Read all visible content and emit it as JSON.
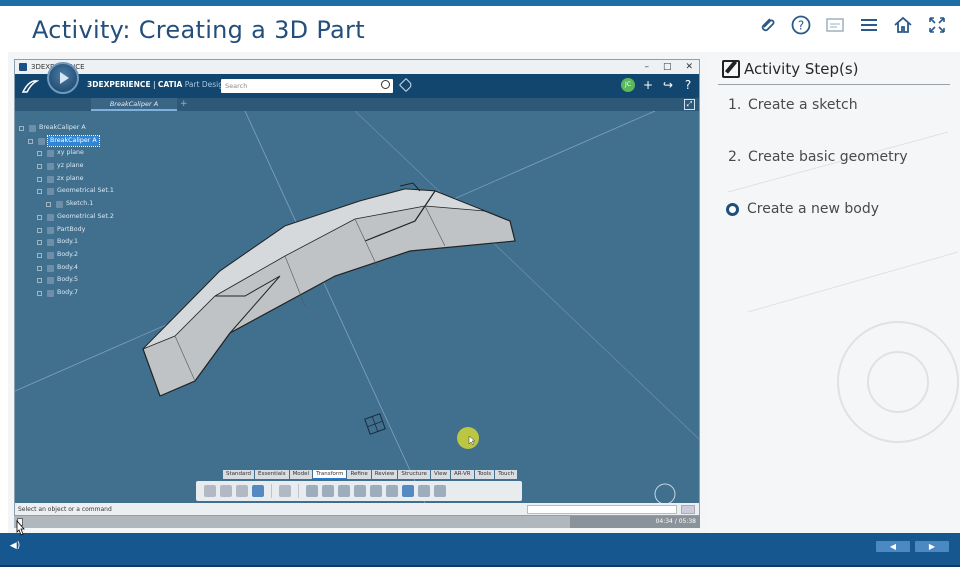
{
  "course": {
    "title": "Activity: Creating a 3D Part",
    "header_icons": [
      "paperclip-icon",
      "help-icon",
      "captions-icon",
      "menu-icon",
      "home-icon",
      "fullscreen-icon"
    ]
  },
  "app": {
    "window_title": "3DEXPERIENCE",
    "window_controls": [
      "–",
      "□",
      "✕"
    ],
    "brand_bold": "3DEXPERIENCE",
    "brand_separator": " | ",
    "brand_app": "CATIA",
    "brand_sub": " Part Design",
    "search_placeholder": "Search",
    "avatar_initials": "JC",
    "document_tab": "BreakCaliper A",
    "tree": [
      {
        "label": "BreakCaliper A",
        "indent": 0,
        "selected": false
      },
      {
        "label": "BreakCaliper A",
        "indent": 1,
        "selected": true
      },
      {
        "label": "xy plane",
        "indent": 2,
        "selected": false
      },
      {
        "label": "yz plane",
        "indent": 2,
        "selected": false
      },
      {
        "label": "zx plane",
        "indent": 2,
        "selected": false
      },
      {
        "label": "Geometrical Set.1",
        "indent": 2,
        "selected": false
      },
      {
        "label": "Sketch.1",
        "indent": 3,
        "selected": false
      },
      {
        "label": "Geometrical Set.2",
        "indent": 2,
        "selected": false
      },
      {
        "label": "PartBody",
        "indent": 2,
        "selected": false
      },
      {
        "label": "Body.1",
        "indent": 2,
        "selected": false
      },
      {
        "label": "Body.2",
        "indent": 2,
        "selected": false
      },
      {
        "label": "Body.4",
        "indent": 2,
        "selected": false
      },
      {
        "label": "Body.5",
        "indent": 2,
        "selected": false
      },
      {
        "label": "Body.7",
        "indent": 2,
        "selected": false
      }
    ],
    "section_tabs": [
      "Standard",
      "Essentials",
      "Model",
      "Transform",
      "Refine",
      "Review",
      "Structure",
      "View",
      "AR-VR",
      "Tools",
      "Touch"
    ],
    "active_section_tab": "Transform",
    "status_text": "Select an object or a command"
  },
  "player": {
    "time": "04:34 / 05:38",
    "progress": 0.81
  },
  "steps": {
    "title": "Activity Step(s)",
    "items": [
      {
        "number": "1.",
        "label": "Create a sketch"
      },
      {
        "number": "2.",
        "label": "Create basic geometry"
      }
    ],
    "current": "Create a new body"
  },
  "nav": {
    "prev_label": "◀",
    "next_label": "▶"
  },
  "colors": {
    "accent": "#17578f",
    "title": "#244f7a",
    "viewport_bg": "#41708f"
  }
}
